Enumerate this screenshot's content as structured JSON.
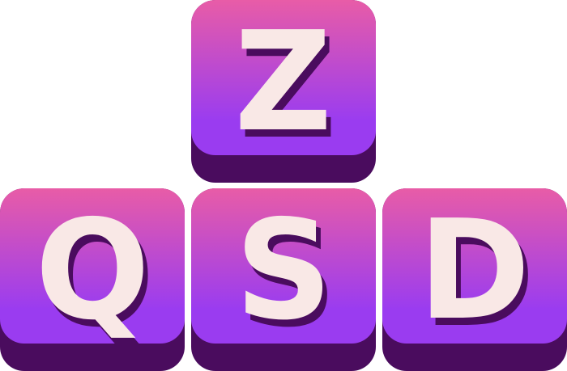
{
  "colors": {
    "key_top": "#e85ca7",
    "key_bottom": "#9a3cf0",
    "key_shadow": "#4a0c5e",
    "letter_fill": "#f9e8e6",
    "letter_shadow": "#4a0c5e"
  },
  "keys": [
    {
      "id": "z",
      "label": "Z"
    },
    {
      "id": "q",
      "label": "Q"
    },
    {
      "id": "s",
      "label": "S"
    },
    {
      "id": "d",
      "label": "D"
    }
  ]
}
